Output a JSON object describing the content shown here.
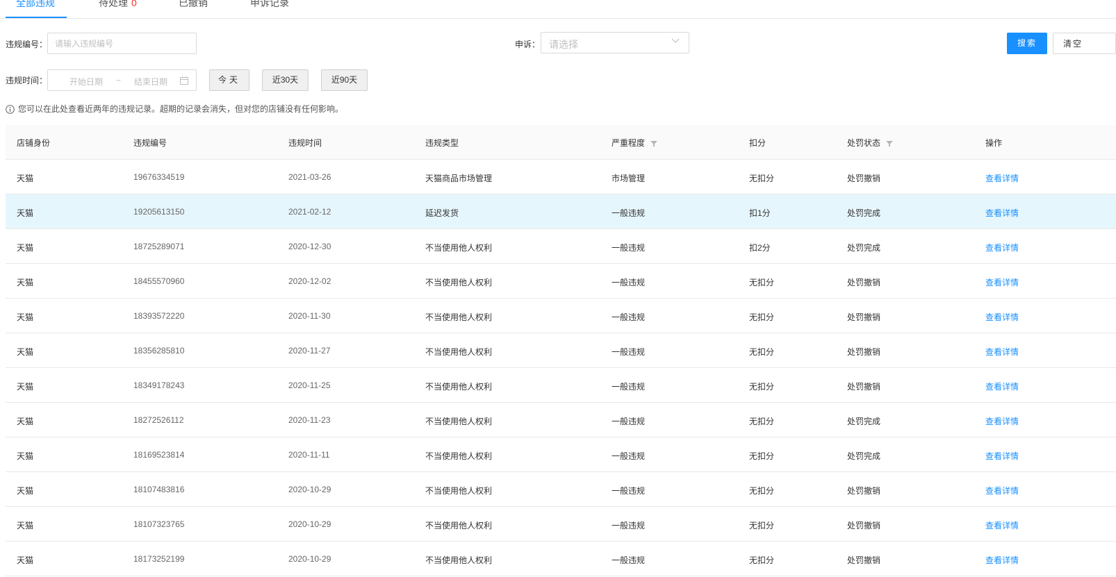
{
  "tabs": [
    {
      "label": "全部违规"
    },
    {
      "label": "待处理",
      "count": "0"
    },
    {
      "label": "已撤销"
    },
    {
      "label": "申诉记录"
    }
  ],
  "filters": {
    "violation_no_label": "违规编号：",
    "violation_no_placeholder": "请输入违规编号",
    "appeal_label": "申诉：",
    "appeal_placeholder": "请选择",
    "search_button": "搜索",
    "clear_button": "清空",
    "time_label": "违规时间：",
    "start_placeholder": "开始日期",
    "range_sep": "~",
    "end_placeholder": "结束日期",
    "quick": [
      "今天",
      "近30天",
      "近90天"
    ]
  },
  "tip": "您可以在此处查看近两年的违规记录。超期的记录会消失，但对您的店铺没有任何影响。",
  "table": {
    "columns": [
      "店铺身份",
      "违规编号",
      "违规时间",
      "违规类型",
      "严重程度",
      "扣分",
      "处罚状态",
      "操作"
    ],
    "rows": [
      [
        "天猫",
        "19676334519",
        "2021-03-26",
        "天猫商品市场管理",
        "市场管理",
        "无扣分",
        "处罚撤销",
        "查看详情"
      ],
      [
        "天猫",
        "19205613150",
        "2021-02-12",
        "延迟发货",
        "一般违规",
        "扣1分",
        "处罚完成",
        "查看详情"
      ],
      [
        "天猫",
        "18725289071",
        "2020-12-30",
        "不当使用他人权利",
        "一般违规",
        "扣2分",
        "处罚完成",
        "查看详情"
      ],
      [
        "天猫",
        "18455570960",
        "2020-12-02",
        "不当使用他人权利",
        "一般违规",
        "无扣分",
        "处罚撤销",
        "查看详情"
      ],
      [
        "天猫",
        "18393572220",
        "2020-11-30",
        "不当使用他人权利",
        "一般违规",
        "无扣分",
        "处罚撤销",
        "查看详情"
      ],
      [
        "天猫",
        "18356285810",
        "2020-11-27",
        "不当使用他人权利",
        "一般违规",
        "无扣分",
        "处罚撤销",
        "查看详情"
      ],
      [
        "天猫",
        "18349178243",
        "2020-11-25",
        "不当使用他人权利",
        "一般违规",
        "无扣分",
        "处罚撤销",
        "查看详情"
      ],
      [
        "天猫",
        "18272526112",
        "2020-11-23",
        "不当使用他人权利",
        "一般违规",
        "无扣分",
        "处罚完成",
        "查看详情"
      ],
      [
        "天猫",
        "18169523814",
        "2020-11-11",
        "不当使用他人权利",
        "一般违规",
        "无扣分",
        "处罚完成",
        "查看详情"
      ],
      [
        "天猫",
        "18107483816",
        "2020-10-29",
        "不当使用他人权利",
        "一般违规",
        "无扣分",
        "处罚撤销",
        "查看详情"
      ],
      [
        "天猫",
        "18107323765",
        "2020-10-29",
        "不当使用他人权利",
        "一般违规",
        "无扣分",
        "处罚撤销",
        "查看详情"
      ],
      [
        "天猫",
        "18173252199",
        "2020-10-29",
        "不当使用他人权利",
        "一般违规",
        "无扣分",
        "处罚撤销",
        "查看详情"
      ]
    ]
  },
  "colors": {
    "accent": "#1890ff",
    "danger": "#ff2d2d",
    "row_highlight": "#e6f6fd"
  },
  "icons": {
    "info": "info-circle-icon",
    "calendar": "calendar-icon",
    "chevron": "chevron-down-icon",
    "filter": "filter-icon"
  }
}
